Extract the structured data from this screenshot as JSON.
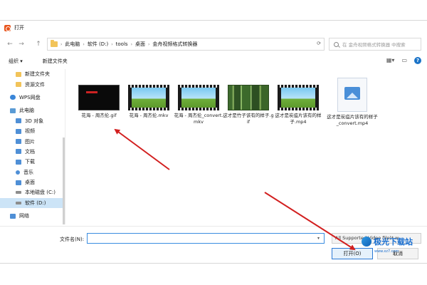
{
  "window": {
    "title": "打开"
  },
  "nav": {
    "back": "←",
    "forward": "→",
    "up": "↑"
  },
  "address": {
    "crumbs": [
      "此电脑",
      "软件 (D:)",
      "tools",
      "桌面",
      "金舟视频格式转换器"
    ],
    "separator": "›"
  },
  "search": {
    "placeholder": "在 金舟视频格式转换器 中搜索"
  },
  "toolbar": {
    "organize": "组织 ▾",
    "new_folder": "新建文件夹",
    "help": "?"
  },
  "sidebar": {
    "items": [
      {
        "label": "新建文件夹",
        "icon": "folder-icon"
      },
      {
        "label": "资源文件",
        "icon": "folder-icon"
      },
      {
        "label": "WPS网盘",
        "icon": "cloud-icon"
      },
      {
        "label": "此电脑",
        "icon": "computer-icon"
      },
      {
        "label": "3D 对象",
        "icon": "cube-icon"
      },
      {
        "label": "视频",
        "icon": "video-icon"
      },
      {
        "label": "图片",
        "icon": "picture-icon"
      },
      {
        "label": "文档",
        "icon": "document-icon"
      },
      {
        "label": "下载",
        "icon": "download-icon"
      },
      {
        "label": "音乐",
        "icon": "music-icon"
      },
      {
        "label": "桌面",
        "icon": "desktop-icon"
      },
      {
        "label": "本地磁盘 (C:)",
        "icon": "drive-icon"
      },
      {
        "label": "软件 (D:)",
        "icon": "drive-icon"
      },
      {
        "label": "网络",
        "icon": "network-icon"
      }
    ]
  },
  "files": [
    {
      "name": "花海 - 周杰伦.gif",
      "kind": "gif-dark"
    },
    {
      "name": "花海 - 周杰伦.mkv",
      "kind": "video"
    },
    {
      "name": "花海 - 周杰伦_convert.mkv",
      "kind": "video"
    },
    {
      "name": "这才是竹子该有的样子.gif",
      "kind": "gif-bamboo"
    },
    {
      "name": "这才是炭疽片该有的样子.mp4",
      "kind": "video"
    },
    {
      "name": "这才是炭疽片该有的样子_convert.mp4",
      "kind": "image-doc"
    }
  ],
  "bottom": {
    "filename_label": "文件名(N):",
    "filename_value": "",
    "file_type": "All Supported Video file(*.w",
    "open_label": "打开(O)",
    "cancel_label": "取消"
  },
  "watermark": {
    "text": "极光下载站",
    "sub": "www.xz7.com"
  },
  "colors": {
    "accent": "#3b8de0",
    "arrow": "#d21f1f",
    "selection": "#cce4f7"
  }
}
